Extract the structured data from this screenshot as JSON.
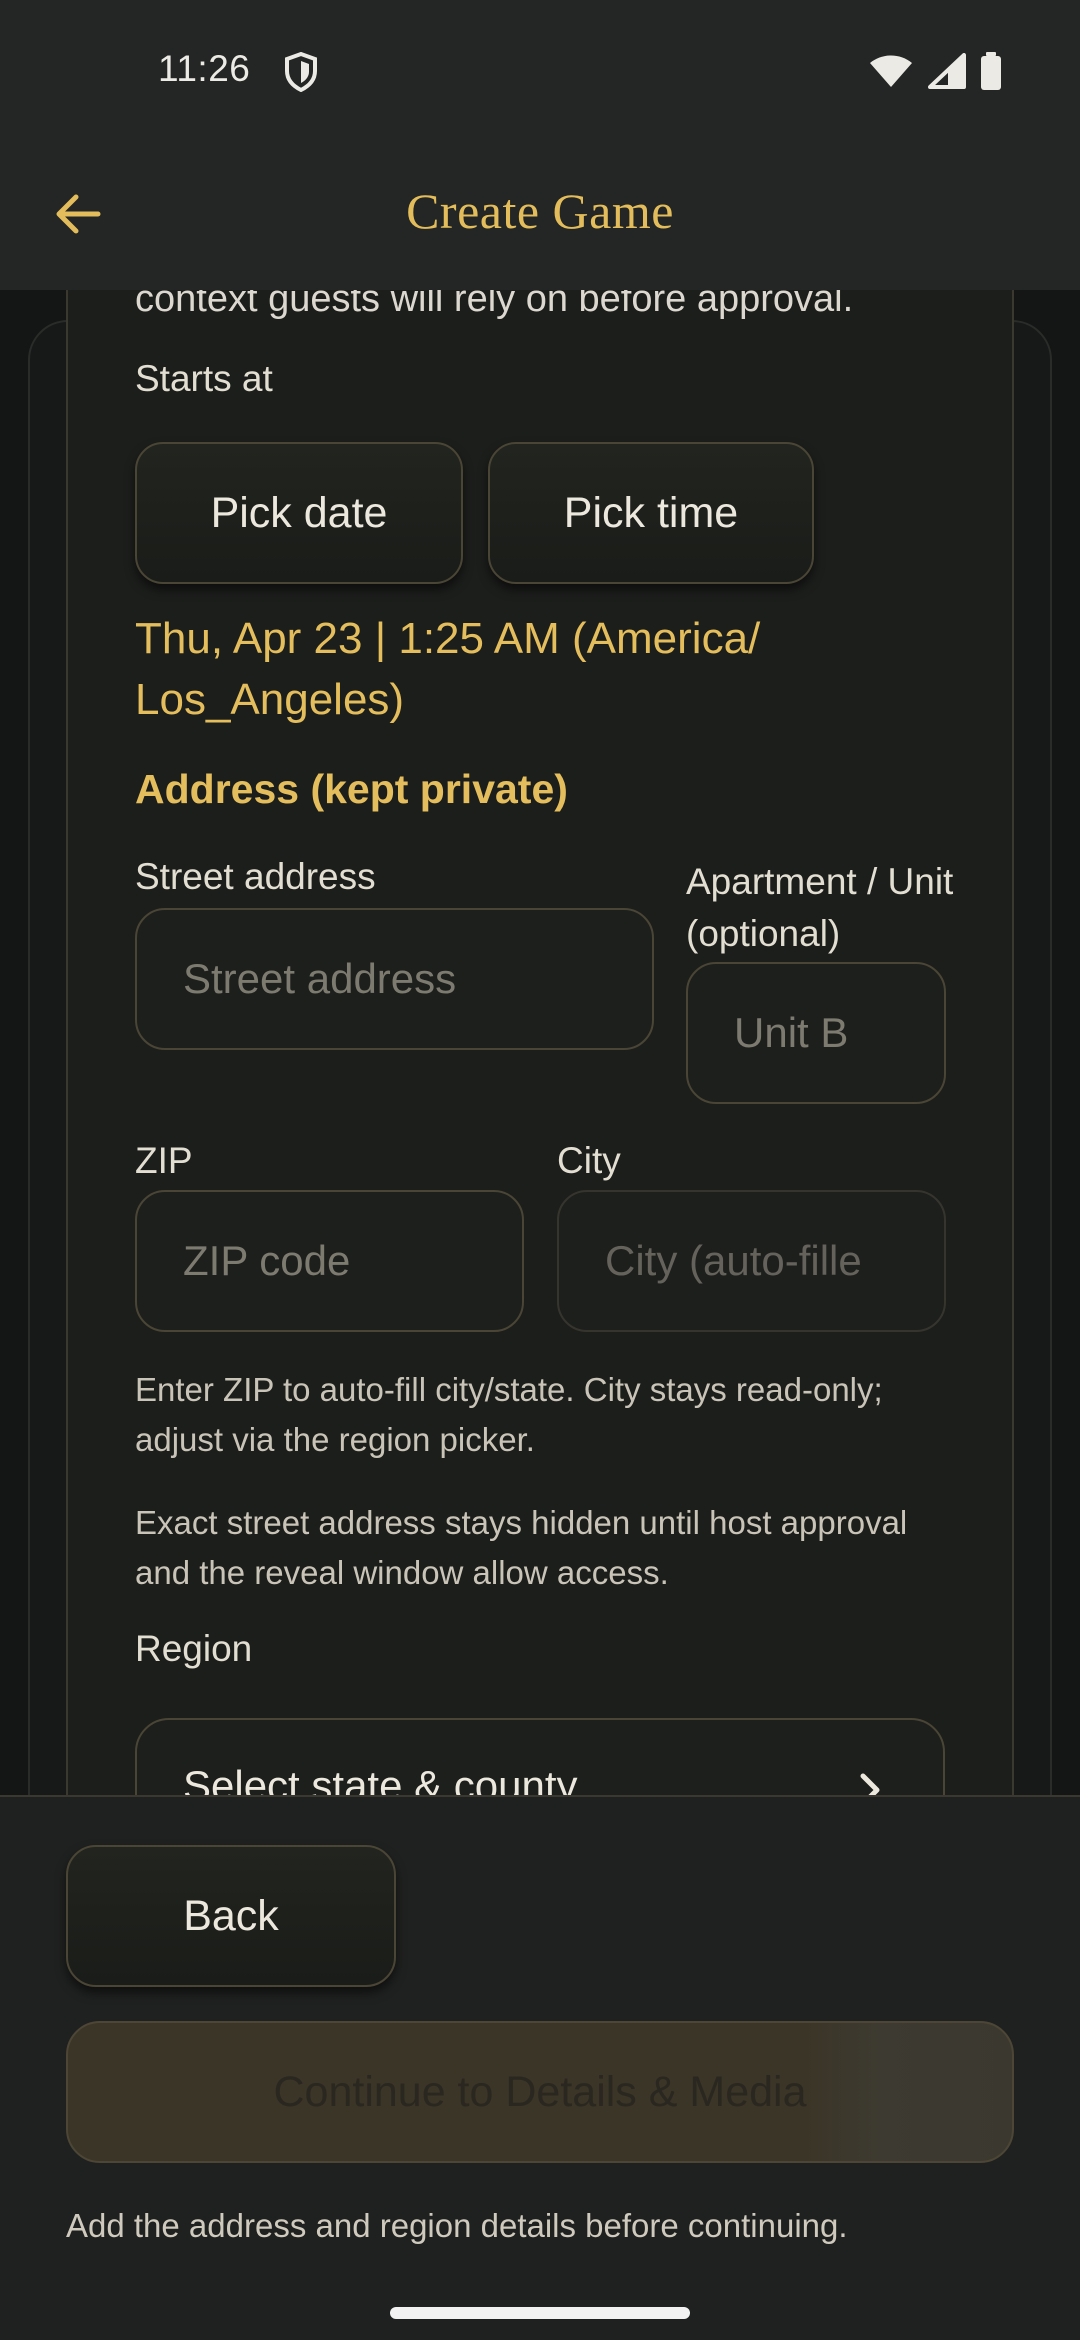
{
  "status_bar": {
    "time": "11:26",
    "icons": [
      "shield-icon",
      "wifi-icon",
      "signal-icon",
      "battery-icon"
    ]
  },
  "app_bar": {
    "title": "Create Game",
    "back_icon": "arrow-left-icon"
  },
  "form": {
    "cut_off_text": "context guests will rely on before approval.",
    "starts_at_label": "Starts at",
    "pick_date_label": "Pick date",
    "pick_time_label": "Pick time",
    "selected_datetime": "Thu, Apr 23 | 1:25 AM (America/ Los_Angeles)",
    "address_section_title": "Address (kept private)",
    "street_label": "Street address",
    "street_placeholder": "Street address",
    "unit_label": "Apartment / Unit (optional)",
    "unit_placeholder": "Unit B",
    "zip_label": "ZIP",
    "zip_placeholder": "ZIP code",
    "city_label": "City",
    "city_placeholder": "City (auto-fille",
    "helper_zip": "Enter ZIP to auto-fill city/state. City stays read-only; adjust via the region picker.",
    "helper_privacy": "Exact street address stays hidden until host approval and the reveal window allow access.",
    "region_label": "Region",
    "region_select_text": "Select state & county"
  },
  "bottom": {
    "back_label": "Back",
    "continue_label": "Continue to Details & Media",
    "continue_hint": "Add the address and region details before continuing."
  },
  "colors": {
    "accent_gold": "#e4bd5c",
    "background": "#1f2120",
    "card": "#1c1e1c",
    "border": "#4a4535"
  }
}
